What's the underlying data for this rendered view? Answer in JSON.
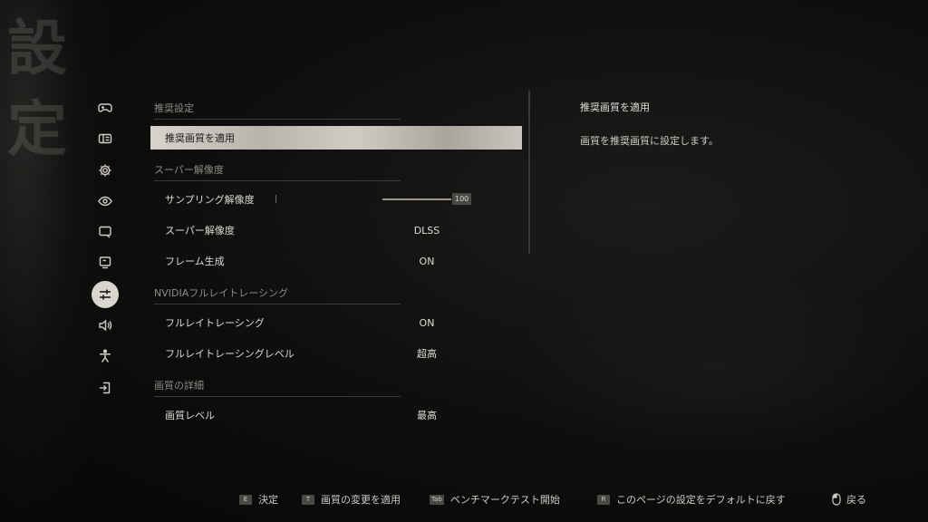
{
  "background": {
    "calligraphy": "設 定"
  },
  "sidebar": {
    "items": [
      {
        "icon": "gamepad-icon",
        "active": false
      },
      {
        "icon": "controls-icon",
        "active": false
      },
      {
        "icon": "gear-icon",
        "active": false
      },
      {
        "icon": "eye-icon",
        "active": false
      },
      {
        "icon": "display-icon",
        "active": false
      },
      {
        "icon": "monitor-icon",
        "active": false
      },
      {
        "icon": "sliders-icon",
        "active": true
      },
      {
        "icon": "speaker-icon",
        "active": false
      },
      {
        "icon": "accessibility-icon",
        "active": false
      },
      {
        "icon": "exit-icon",
        "active": false
      }
    ]
  },
  "settings": {
    "sections": [
      {
        "title": "推奨設定"
      },
      {
        "title": "スーパー解像度"
      },
      {
        "title": "NVIDIAフルレイトレーシング"
      },
      {
        "title": "画質の詳細"
      }
    ],
    "rows": [
      {
        "label": "推奨画質を適用",
        "value": ""
      },
      {
        "label": "サンプリング解像度",
        "value": "100"
      },
      {
        "label": "スーパー解像度",
        "value": "DLSS"
      },
      {
        "label": "フレーム生成",
        "value": "ON"
      },
      {
        "label": "フルレイトレーシング",
        "value": "ON"
      },
      {
        "label": "フルレイトレーシングレベル",
        "value": "超高"
      },
      {
        "label": "画質レベル",
        "value": "最高"
      }
    ],
    "slider_fraction": 1.0
  },
  "detail": {
    "title": "推奨画質を適用",
    "description": "画質を推奨画質に設定します。"
  },
  "footer": {
    "hints": [
      {
        "key": "E",
        "label": "決定"
      },
      {
        "key": "T",
        "label": "画質の変更を適用"
      },
      {
        "key": "Tab",
        "label": "ベンチマークテスト開始"
      },
      {
        "key": "R",
        "label": "このページの設定をデフォルトに戻す"
      },
      {
        "key": "",
        "label": "戻る"
      }
    ]
  }
}
